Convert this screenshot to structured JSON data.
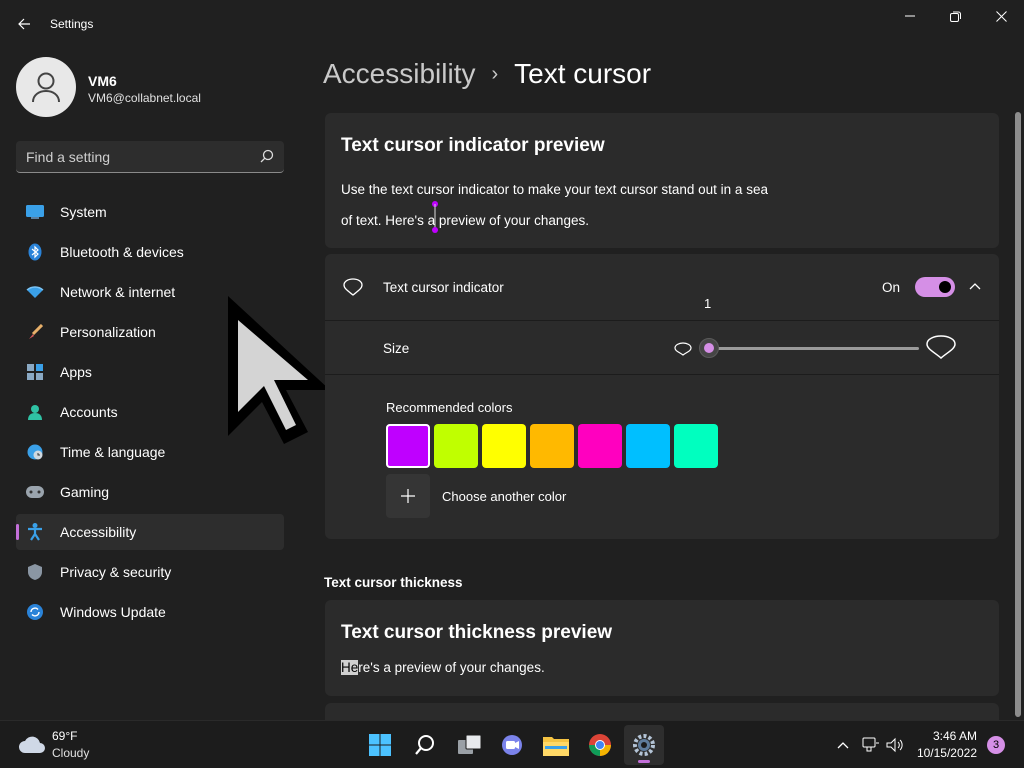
{
  "window": {
    "title": "Settings",
    "back_icon": "back-arrow-icon",
    "controls": [
      "minimize-icon",
      "restore-icon",
      "close-icon"
    ]
  },
  "user": {
    "name": "VM6",
    "email": "VM6@collabnet.local"
  },
  "search": {
    "placeholder": "Find a setting",
    "value": ""
  },
  "sidebar": {
    "items": [
      {
        "label": "System",
        "icon": "monitor-icon",
        "active": false
      },
      {
        "label": "Bluetooth & devices",
        "icon": "bluetooth-icon",
        "active": false
      },
      {
        "label": "Network & internet",
        "icon": "wifi-icon",
        "active": false
      },
      {
        "label": "Personalization",
        "icon": "brush-icon",
        "active": false
      },
      {
        "label": "Apps",
        "icon": "apps-icon",
        "active": false
      },
      {
        "label": "Accounts",
        "icon": "person-icon",
        "active": false
      },
      {
        "label": "Time & language",
        "icon": "globe-clock-icon",
        "active": false
      },
      {
        "label": "Gaming",
        "icon": "gamepad-icon",
        "active": false
      },
      {
        "label": "Accessibility",
        "icon": "accessibility-icon",
        "active": true
      },
      {
        "label": "Privacy & security",
        "icon": "shield-icon",
        "active": false
      },
      {
        "label": "Windows Update",
        "icon": "update-icon",
        "active": false
      }
    ]
  },
  "breadcrumb": {
    "parent": "Accessibility",
    "separator": "›",
    "current": "Text cursor"
  },
  "preview": {
    "title": "Text cursor indicator preview",
    "line1_a": "Use the text cur",
    "line1_b": "sor indicator to make your text cursor stand out in a sea",
    "line2_a": "of text. Here's a",
    "line2_b": " preview of your changes."
  },
  "indicator": {
    "label": "Text cursor indicator",
    "icon": "cursor-indicator-icon",
    "toggle_state": "On",
    "toggle_on": true,
    "expand_icon": "chevron-up-icon",
    "size_label": "Size",
    "size_value": "1",
    "size_min": 1,
    "size_max": 5,
    "small_icon": "indicator-small-icon",
    "large_icon": "indicator-large-icon",
    "colors_label": "Recommended colors",
    "colors": [
      "#bf00ff",
      "#c0ff00",
      "#ffff00",
      "#ffb900",
      "#ff00bf",
      "#00bfff",
      "#00ffbf"
    ],
    "selected_color_index": 0,
    "choose_color_label": "Choose another color",
    "plus_icon": "plus-icon"
  },
  "thickness": {
    "heading": "Text cursor thickness",
    "card_title": "Text cursor thickness preview",
    "text_highlight": "He",
    "text_rest": "re's a preview of your changes."
  },
  "taskbar": {
    "weather_temp": "69°F",
    "weather_cond": "Cloudy",
    "weather_icon": "cloud-icon",
    "apps": [
      "windows-start-icon",
      "search-icon",
      "task-view-icon",
      "teams-chat-icon",
      "file-explorer-icon",
      "chrome-icon",
      "settings-gear-icon"
    ],
    "active_app": "settings-gear-icon",
    "time": "3:46 AM",
    "date": "10/15/2022",
    "notification_count": "3"
  }
}
